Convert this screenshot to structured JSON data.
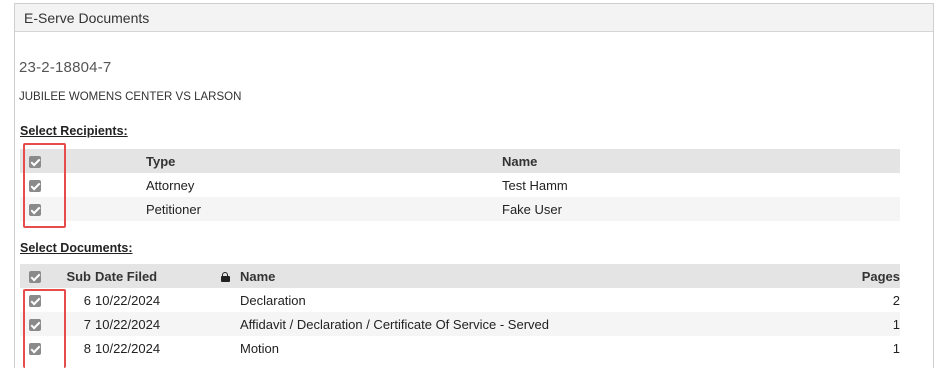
{
  "panel": {
    "title": "E-Serve Documents"
  },
  "case": {
    "number": "23-2-18804-7",
    "name": "JUBILEE WOMENS CENTER VS LARSON"
  },
  "recipients": {
    "section_label": "Select Recipients:",
    "headers": {
      "type": "Type",
      "name": "Name"
    },
    "rows": [
      {
        "type": "Attorney",
        "name": "Test Hamm",
        "checked": true
      },
      {
        "type": "Petitioner",
        "name": "Fake User",
        "checked": true
      }
    ]
  },
  "documents": {
    "section_label": "Select Documents:",
    "headers": {
      "sub": "Sub",
      "date_filed": "Date Filed",
      "name": "Name",
      "pages": "Pages"
    },
    "rows": [
      {
        "sub": "6",
        "date_filed": "10/22/2024",
        "name": "Declaration",
        "pages": "2",
        "checked": true
      },
      {
        "sub": "7",
        "date_filed": "10/22/2024",
        "name": "Affidavit / Declaration / Certificate Of Service - Served",
        "pages": "1",
        "checked": true
      },
      {
        "sub": "8",
        "date_filed": "10/22/2024",
        "name": "Motion",
        "pages": "1",
        "checked": true
      }
    ]
  },
  "colors": {
    "highlight": "#e74c4c",
    "checkbox": "#8a8a8a",
    "header_bg": "#e4e4e4"
  }
}
